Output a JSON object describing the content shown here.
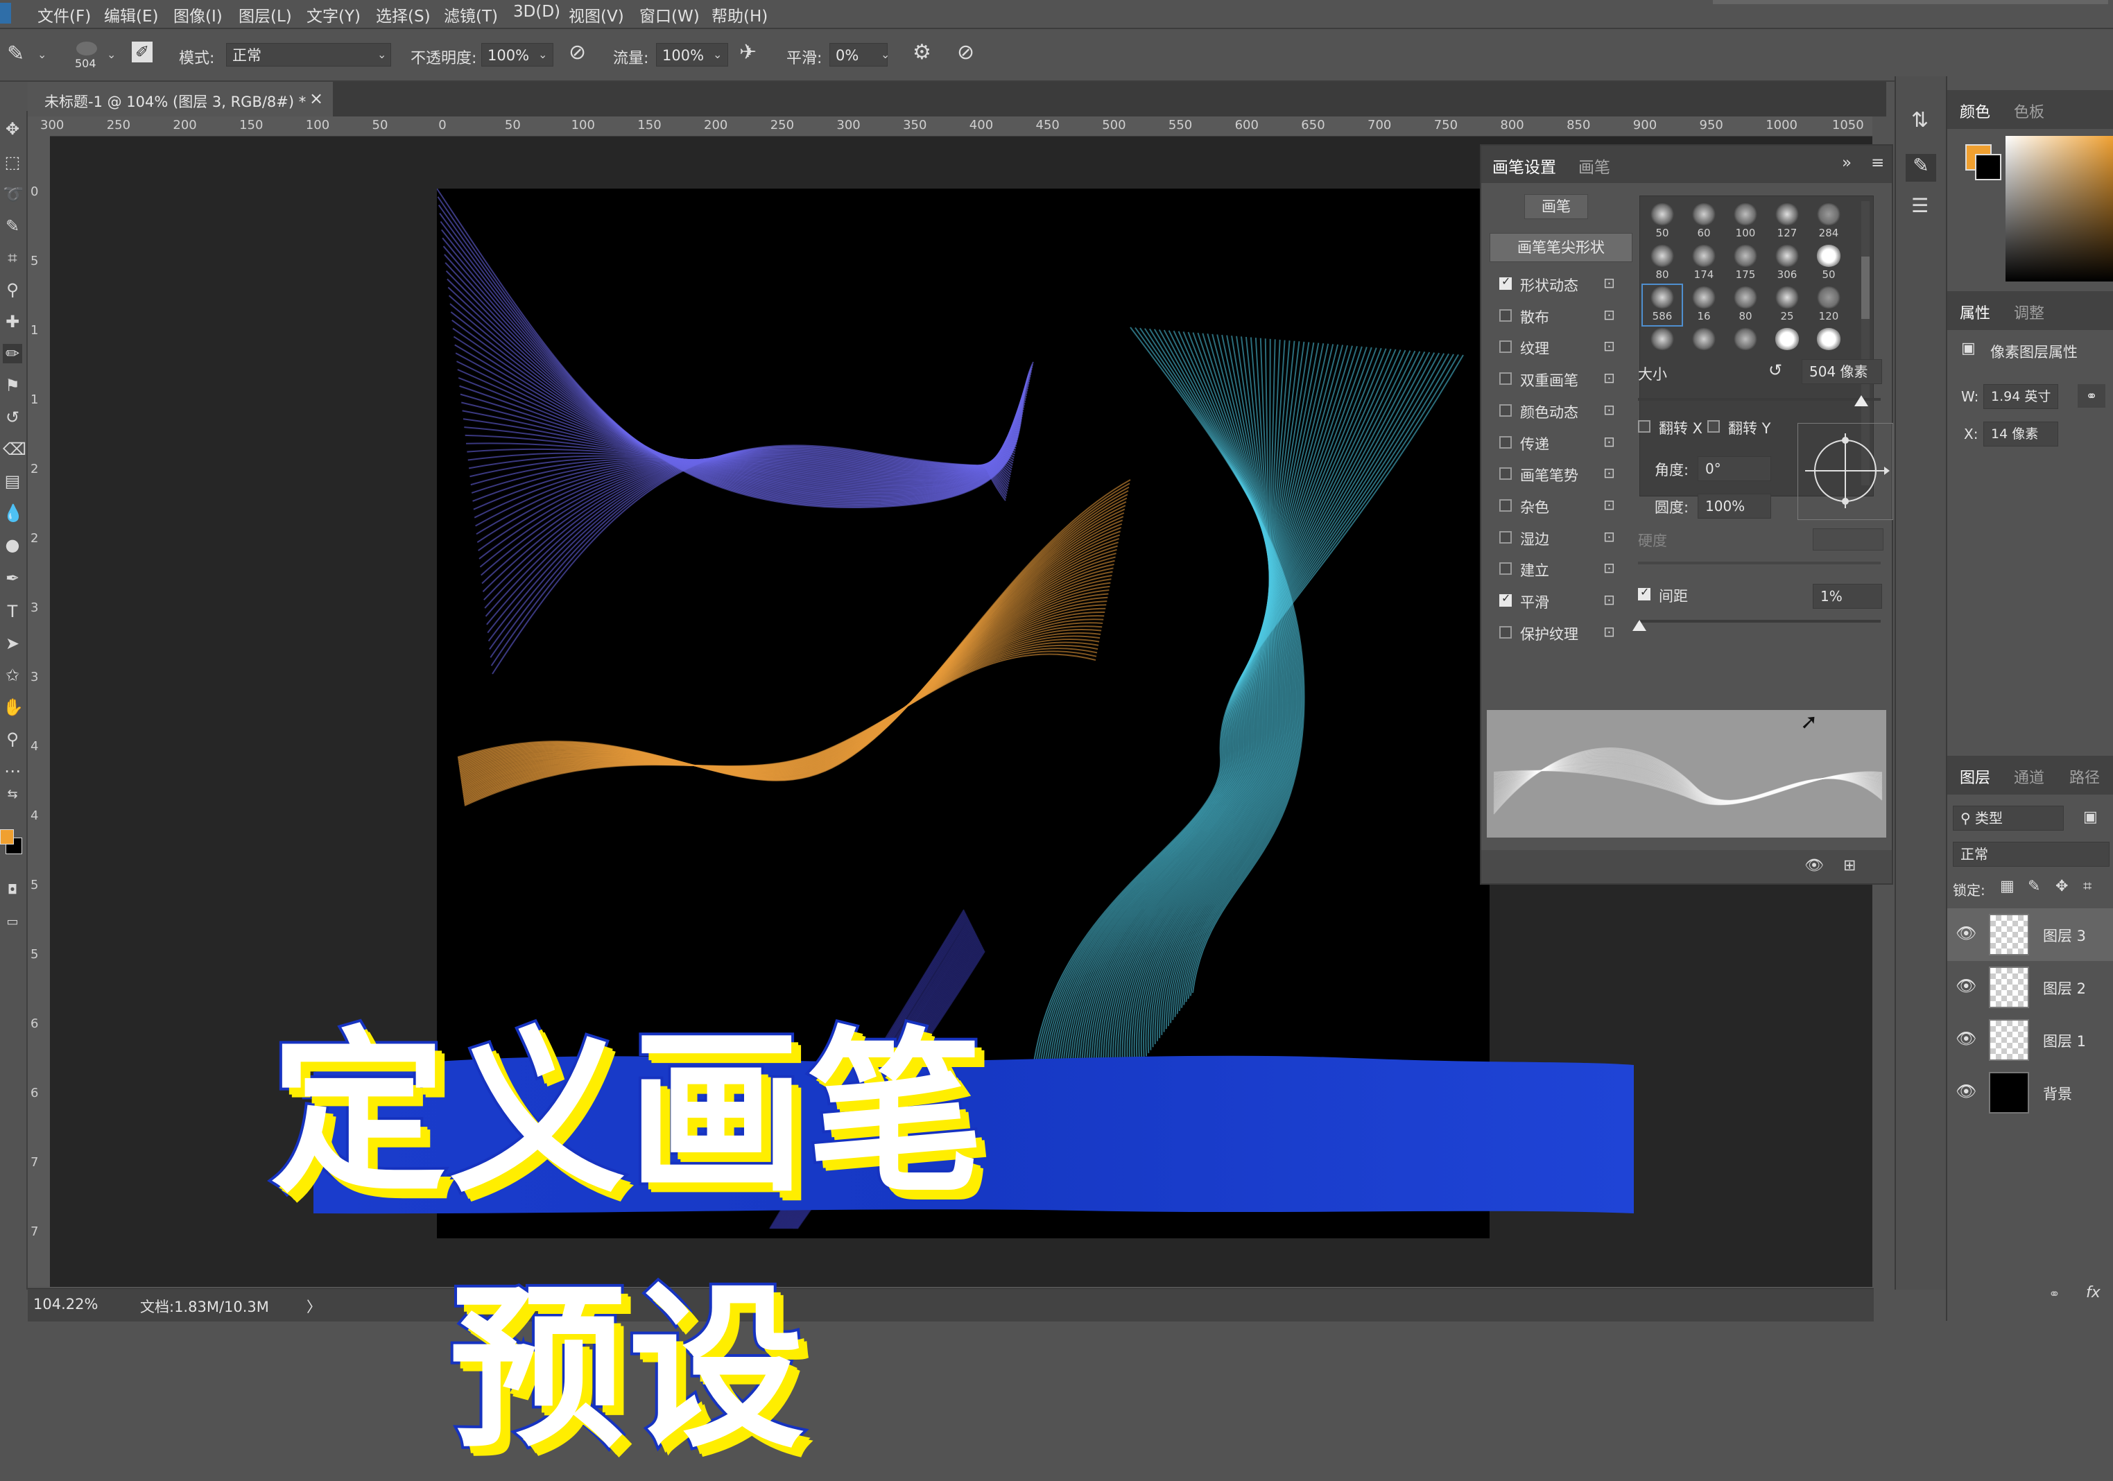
{
  "menubar": {
    "items": [
      "文件(F)",
      "编辑(E)",
      "图像(I)",
      "图层(L)",
      "文字(Y)",
      "选择(S)",
      "滤镜(T)",
      "3D(D)",
      "视图(V)",
      "窗口(W)",
      "帮助(H)"
    ]
  },
  "options": {
    "brush_size": "504",
    "mode_label": "模式:",
    "mode_value": "正常",
    "opacity_label": "不透明度:",
    "opacity_value": "100%",
    "flow_label": "流量:",
    "flow_value": "100%",
    "smoothing_label": "平滑:",
    "smoothing_value": "0%"
  },
  "document": {
    "tab_title": "未标题-1 @ 104% (图层 3, RGB/8#) *",
    "close": "×",
    "ruler_ticks": [
      "300",
      "250",
      "200",
      "150",
      "100",
      "50",
      "0",
      "50",
      "100",
      "150",
      "200",
      "250",
      "300",
      "350",
      "400",
      "450",
      "500",
      "550",
      "600",
      "650",
      "700",
      "750",
      "800",
      "850",
      "900",
      "950",
      "1000",
      "1050"
    ]
  },
  "status": {
    "zoom": "104.22%",
    "doc_info": "文档:1.83M/10.3M",
    "arrow": "〉"
  },
  "brush_panel": {
    "tab_settings": "画笔设置",
    "tab_brushes": "画笔",
    "brushes_button": "画笔",
    "tip_shape_button": "画笔笔尖形状",
    "options": [
      {
        "label": "形状动态",
        "checked": true
      },
      {
        "label": "散布",
        "checked": false
      },
      {
        "label": "纹理",
        "checked": false
      },
      {
        "label": "双重画笔",
        "checked": false
      },
      {
        "label": "颜色动态",
        "checked": false
      },
      {
        "label": "传递",
        "checked": false
      },
      {
        "label": "画笔笔势",
        "checked": false
      },
      {
        "label": "杂色",
        "checked": false
      },
      {
        "label": "湿边",
        "checked": false
      },
      {
        "label": "建立",
        "checked": false
      },
      {
        "label": "平滑",
        "checked": true
      },
      {
        "label": "保护纹理",
        "checked": false
      }
    ],
    "lock_icon": "🔒",
    "tip_sizes": [
      "50",
      "60",
      "100",
      "127",
      "284",
      "80",
      "174",
      "175",
      "306",
      "50",
      "586",
      "16",
      "80",
      "25",
      "120",
      "",
      "",
      "",
      "",
      ""
    ],
    "size_label": "大小",
    "size_value": "504 像素",
    "flip_x": "翻转 X",
    "flip_y": "翻转 Y",
    "angle_label": "角度:",
    "angle_value": "0°",
    "roundness_label": "圆度:",
    "roundness_value": "100%",
    "hardness_label": "硬度",
    "spacing_label": "间距",
    "spacing_checked": true,
    "spacing_value": "1%"
  },
  "right_panels": {
    "color_tab": "颜色",
    "swatches_tab": "色板",
    "properties_tab": "属性",
    "adjust_tab": "调整",
    "pixel_layer_props": "像素图层属性",
    "w_label": "W:",
    "w_value": "1.94 英寸",
    "x_label": "X:",
    "x_value": "14 像素",
    "layers_tab": "图层",
    "channels_tab": "通道",
    "paths_tab": "路径",
    "filter_kind": "类型",
    "blend_mode": "正常",
    "lock_label": "锁定:",
    "layers": [
      {
        "name": "图层 3",
        "type": "transparent",
        "selected": true
      },
      {
        "name": "图层 2",
        "type": "transparent",
        "selected": false
      },
      {
        "name": "图层 1",
        "type": "transparent",
        "selected": false
      },
      {
        "name": "背景",
        "type": "black",
        "selected": false
      }
    ],
    "fx_label": "fx"
  },
  "overlay": {
    "title": "定义画笔预设"
  },
  "colors": {
    "foreground": "#f0a030",
    "background": "#000000",
    "ui_panel": "#535353",
    "banner_blue": "#1538c8",
    "title_yellow": "#ffee00"
  }
}
